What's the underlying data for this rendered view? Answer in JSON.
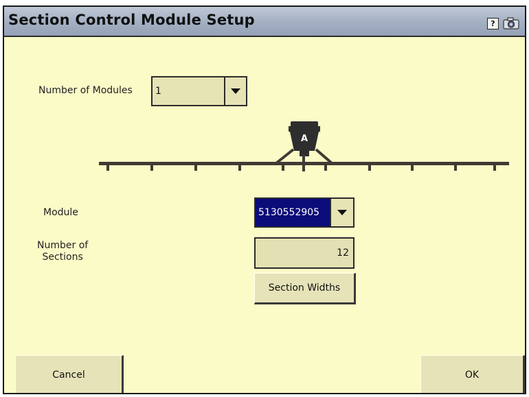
{
  "window": {
    "title": "Section Control Module Setup",
    "help_glyph": "?",
    "icons": [
      "help-icon",
      "camera-icon"
    ]
  },
  "modules": {
    "label": "Number of Modules",
    "value": "1"
  },
  "diagram": {
    "module_letter": "A",
    "colors": {
      "boom": "#3f3a33",
      "tank": "#2e2e2e"
    }
  },
  "module": {
    "label": "Module",
    "value": "5130552905",
    "highlight_color": "#0b0b7a"
  },
  "sections": {
    "label_line1": "Number of",
    "label_line2": "Sections",
    "value": "12"
  },
  "buttons": {
    "section_widths": "Section Widths",
    "cancel": "Cancel",
    "ok": "OK"
  },
  "colors": {
    "background": "#fbfbc7",
    "titlebar": "#a3afc2"
  }
}
